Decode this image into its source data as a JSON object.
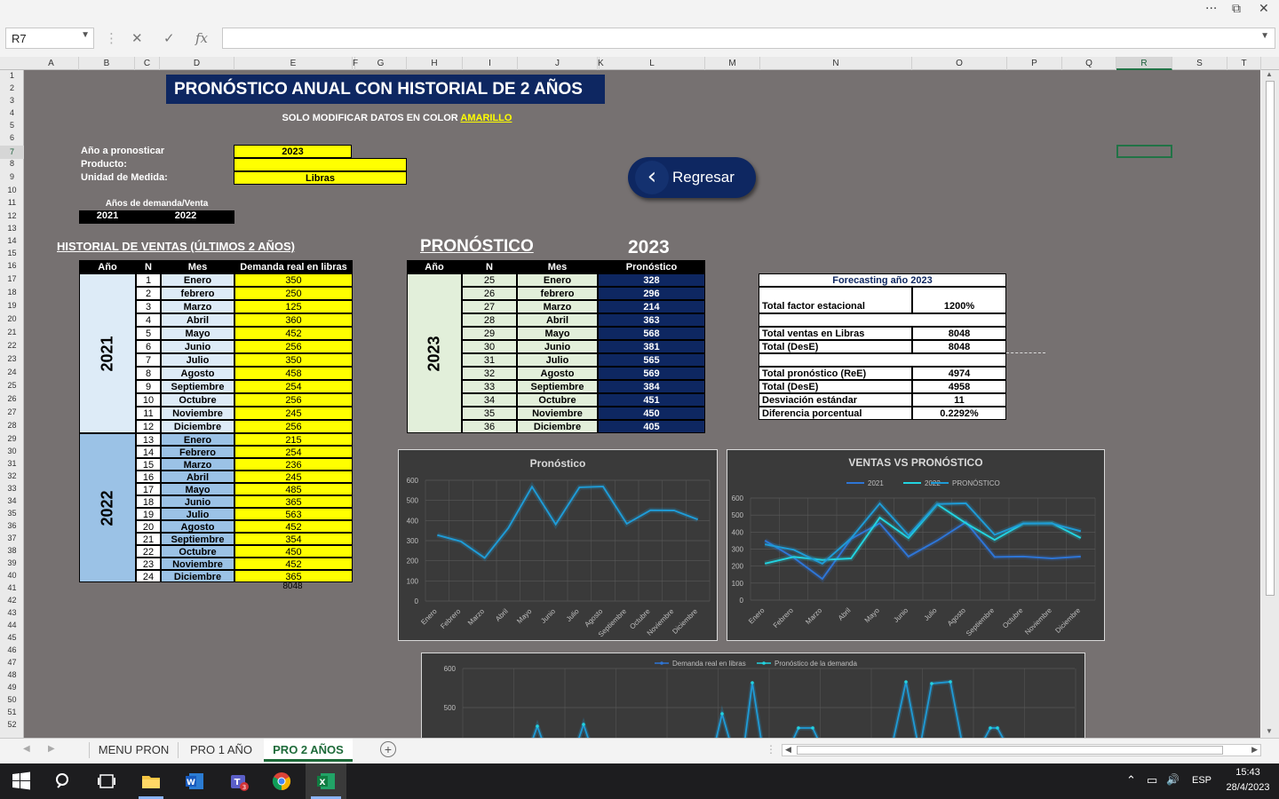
{
  "window": {
    "dots": "···",
    "restore": "⧉",
    "close": "✕"
  },
  "formula_bar": {
    "cell_ref": "R7",
    "cancel": "✕",
    "enter": "✓",
    "fx": "fx",
    "value": ""
  },
  "columns": [
    "A",
    "B",
    "C",
    "D",
    "E",
    "F",
    "G",
    "H",
    "I",
    "J",
    "K",
    "L",
    "M",
    "N",
    "O",
    "P",
    "Q",
    "R",
    "S",
    "T"
  ],
  "rows": [
    "1",
    "2",
    "3",
    "4",
    "5",
    "6",
    "7",
    "8",
    "9",
    "10",
    "11",
    "12",
    "13",
    "14",
    "15",
    "16",
    "17",
    "18",
    "19",
    "20",
    "21",
    "22",
    "23",
    "24",
    "25",
    "26",
    "27",
    "28",
    "29",
    "30",
    "31",
    "32",
    "33",
    "34",
    "35",
    "36",
    "37",
    "38",
    "39",
    "40",
    "41",
    "42",
    "43",
    "44",
    "45",
    "46",
    "47",
    "48",
    "49",
    "50",
    "51",
    "52"
  ],
  "sheet": {
    "main_title": "PRONÓSTICO ANUAL CON HISTORIAL DE 2 AÑOS",
    "subtitle_a": "SOLO MODIFICAR DATOS EN COLOR ",
    "subtitle_b": "AMARILLO",
    "inputs": {
      "year_label": "Año a pronosticar",
      "year_value": "2023",
      "product_label": "Producto:",
      "product_value": "",
      "unit_label": "Unidad de Medida:",
      "unit_value": "Libras"
    },
    "years_caption": "Años de demanda/Venta",
    "year1": "2021",
    "year2": "2022",
    "regresar": "Regresar",
    "history_title": "HISTORIAL DE VENTAS (ÚLTIMOS 2 AÑOS)",
    "history_headers": [
      "Año",
      "N",
      "Mes",
      "Demanda real en libras"
    ],
    "history_2021": [
      [
        "1",
        "Enero",
        "350"
      ],
      [
        "2",
        "febrero",
        "250"
      ],
      [
        "3",
        "Marzo",
        "125"
      ],
      [
        "4",
        "Abril",
        "360"
      ],
      [
        "5",
        "Mayo",
        "452"
      ],
      [
        "6",
        "Junio",
        "256"
      ],
      [
        "7",
        "Julio",
        "350"
      ],
      [
        "8",
        "Agosto",
        "458"
      ],
      [
        "9",
        "Septiembre",
        "254"
      ],
      [
        "10",
        "Octubre",
        "256"
      ],
      [
        "11",
        "Noviembre",
        "245"
      ],
      [
        "12",
        "Diciembre",
        "256"
      ]
    ],
    "history_2022": [
      [
        "13",
        "Enero",
        "215"
      ],
      [
        "14",
        "Febrero",
        "254"
      ],
      [
        "15",
        "Marzo",
        "236"
      ],
      [
        "16",
        "Abril",
        "245"
      ],
      [
        "17",
        "Mayo",
        "485"
      ],
      [
        "18",
        "Junio",
        "365"
      ],
      [
        "19",
        "Julio",
        "563"
      ],
      [
        "20",
        "Agosto",
        "452"
      ],
      [
        "21",
        "Septiembre",
        "354"
      ],
      [
        "22",
        "Octubre",
        "450"
      ],
      [
        "23",
        "Noviembre",
        "452"
      ],
      [
        "24",
        "Diciembre",
        "365"
      ]
    ],
    "history_total": "8048",
    "forecast_title": "PRONÓSTICO",
    "forecast_year": "2023",
    "forecast_headers": [
      "Año",
      "N",
      "Mes",
      "Pronóstico"
    ],
    "forecast_rows": [
      [
        "25",
        "Enero",
        "328"
      ],
      [
        "26",
        "febrero",
        "296"
      ],
      [
        "27",
        "Marzo",
        "214"
      ],
      [
        "28",
        "Abril",
        "363"
      ],
      [
        "29",
        "Mayo",
        "568"
      ],
      [
        "30",
        "Junio",
        "381"
      ],
      [
        "31",
        "Julio",
        "565"
      ],
      [
        "32",
        "Agosto",
        "569"
      ],
      [
        "33",
        "Septiembre",
        "384"
      ],
      [
        "34",
        "Octubre",
        "451"
      ],
      [
        "35",
        "Noviembre",
        "450"
      ],
      [
        "36",
        "Diciembre",
        "405"
      ]
    ],
    "summary": {
      "title": "Forecasting año ",
      "title_year": "2023",
      "rows": [
        [
          "Total factor estacional",
          "1200%"
        ],
        [
          "Total ventas en Libras",
          "8048"
        ],
        [
          "Total (DesE)",
          "8048"
        ],
        [
          "Total pronóstico (ReE)",
          "4974"
        ],
        [
          "Total (DesE)",
          "4958"
        ],
        [
          "Desviación estándar",
          "11"
        ],
        [
          "Diferencia porcentual",
          "0.2292%"
        ]
      ]
    }
  },
  "chart_data": [
    {
      "type": "line",
      "title": "Pronóstico",
      "categories": [
        "Enero",
        "Febrero",
        "Marzo",
        "Abril",
        "Mayo",
        "Junio",
        "Julio",
        "Agosto",
        "Septiembre",
        "Octubre",
        "Noviembre",
        "Diciembre"
      ],
      "yticks": [
        "0",
        "100",
        "200",
        "300",
        "400",
        "500",
        "600"
      ],
      "ylim": [
        0,
        600
      ],
      "series": [
        {
          "values": [
            328,
            296,
            214,
            363,
            568,
            381,
            565,
            569,
            384,
            451,
            450,
            405
          ],
          "color": "#1f9bd6"
        }
      ]
    },
    {
      "type": "line",
      "title": "VENTAS VS PRONÓSTICO",
      "categories": [
        "Enero",
        "Febrero",
        "Marzo",
        "Abril",
        "Mayo",
        "Junio",
        "Julio",
        "Agosto",
        "Septiembre",
        "Octubre",
        "Noviembre",
        "Diciembre"
      ],
      "yticks": [
        "0",
        "100",
        "200",
        "300",
        "400",
        "500",
        "600"
      ],
      "ylim": [
        0,
        600
      ],
      "series": [
        {
          "name": "2021",
          "values": [
            350,
            250,
            125,
            360,
            452,
            256,
            350,
            458,
            254,
            256,
            245,
            256
          ],
          "color": "#2e75d6"
        },
        {
          "name": "2022",
          "values": [
            215,
            254,
            236,
            245,
            485,
            365,
            563,
            452,
            354,
            450,
            452,
            365
          ],
          "color": "#22d3e0"
        },
        {
          "name": "PRONÓSTICO",
          "values": [
            328,
            296,
            214,
            363,
            568,
            381,
            565,
            569,
            384,
            451,
            450,
            405
          ],
          "color": "#1f9bd6"
        }
      ]
    },
    {
      "type": "line",
      "title": "",
      "yticks": [
        "500",
        "600"
      ],
      "series": [
        {
          "name": "Demanda real en libras",
          "color": "#2e75d6"
        },
        {
          "name": "Pronóstico de la demanda",
          "color": "#22d3e0"
        }
      ]
    }
  ],
  "tabs": [
    "MENU PRON",
    "PRO 1 AÑO",
    "PRO 2 AÑOS"
  ],
  "tabs_add": "+",
  "taskbar": {
    "lang": "ESP",
    "time": "15:43",
    "date": "28/4/2023",
    "up_arrow": "⌃",
    "network": "▭",
    "sound": "🔊"
  }
}
